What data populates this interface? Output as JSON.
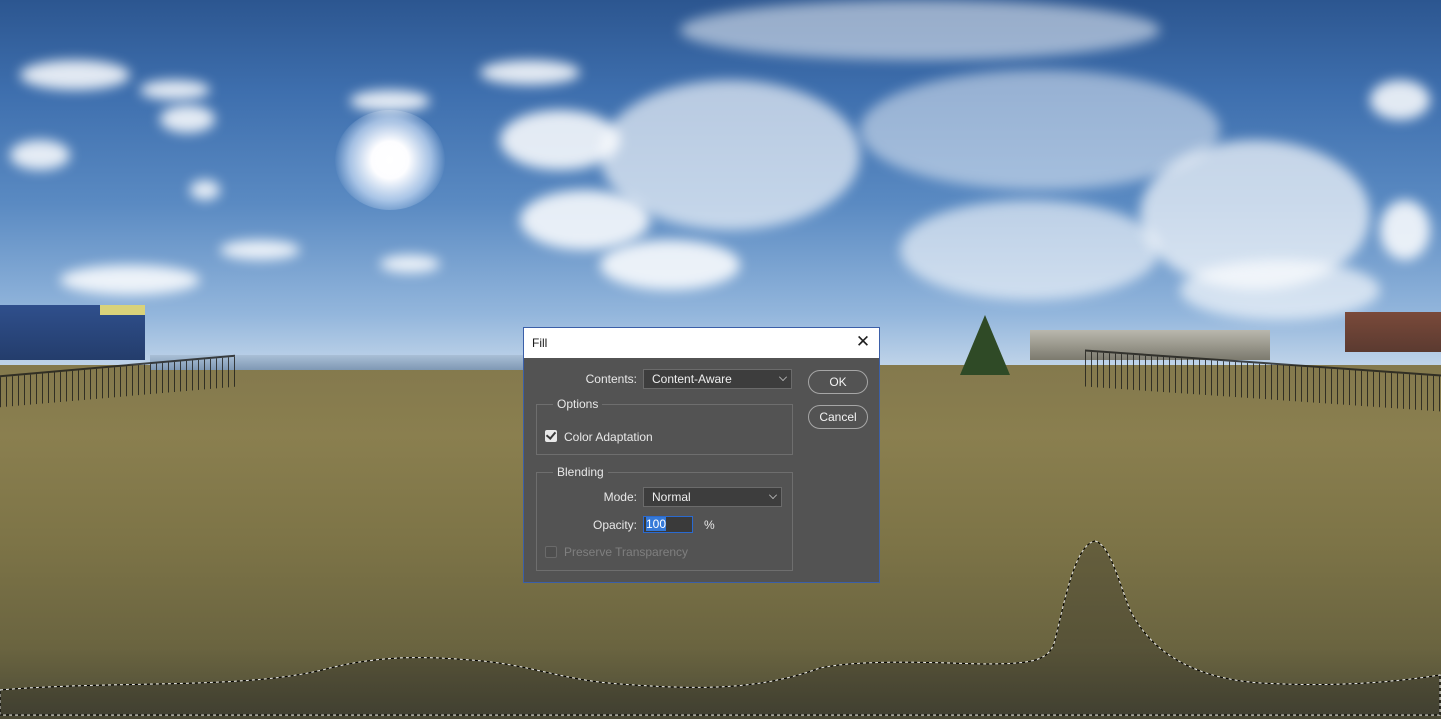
{
  "dialog": {
    "title": "Fill",
    "contents_label": "Contents:",
    "contents_value": "Content-Aware",
    "ok_label": "OK",
    "cancel_label": "Cancel",
    "options_title": "Options",
    "color_adaptation_label": "Color Adaptation",
    "color_adaptation_checked": true,
    "blending_title": "Blending",
    "mode_label": "Mode:",
    "mode_value": "Normal",
    "opacity_label": "Opacity:",
    "opacity_value": "100",
    "opacity_unit": "%",
    "preserve_transparency_label": "Preserve Transparency",
    "preserve_transparency_checked": false,
    "preserve_transparency_enabled": false
  },
  "icons": {
    "close": "close-icon",
    "dropdown": "chevron-down-icon",
    "check": "checkmark-icon"
  },
  "colors": {
    "dialog_bg": "#535353",
    "accent": "#3579d8"
  }
}
